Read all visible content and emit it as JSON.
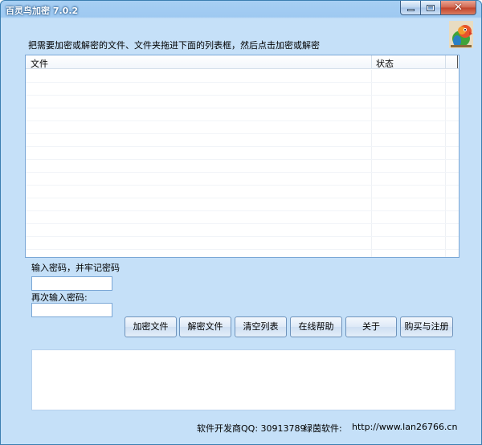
{
  "window": {
    "title": "百灵鸟加密 7.0.2"
  },
  "instruction": "把需要加密或解密的文件、文件夹拖进下面的列表框，然后点击加密或解密",
  "list": {
    "columns": [
      "文件",
      "状态"
    ],
    "rows": []
  },
  "password": {
    "label1": "输入密码，并牢记密码",
    "value1": "",
    "label2": "再次输入密码:",
    "value2": ""
  },
  "buttons": {
    "encrypt": "加密文件",
    "decrypt": "解密文件",
    "clear": "清空列表",
    "help": "在线帮助",
    "about": "关于",
    "buy": "购买与注册"
  },
  "log": {
    "text": ""
  },
  "footer": {
    "developer": "软件开发商QQ: 30913789",
    "software_label": "绿茵软件:",
    "url": "http://www.lan26766.cn"
  },
  "icons": {
    "logo": "lovebird-logo-icon",
    "minimize": "minimize-icon",
    "maximize": "maximize-icon",
    "close": "close-icon"
  }
}
